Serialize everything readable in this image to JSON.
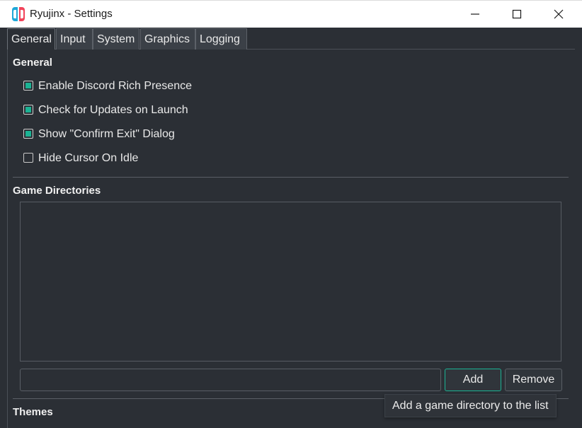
{
  "window": {
    "title": "Ryujinx - Settings",
    "controls": {
      "minimize": "minimize-icon",
      "maximize": "maximize-icon",
      "close": "close-icon"
    }
  },
  "tabs": [
    {
      "label": "General",
      "active": true
    },
    {
      "label": "Input",
      "active": false
    },
    {
      "label": "System",
      "active": false
    },
    {
      "label": "Graphics",
      "active": false
    },
    {
      "label": "Logging",
      "active": false
    }
  ],
  "general": {
    "header": "General",
    "options": [
      {
        "label": "Enable Discord Rich Presence",
        "checked": true
      },
      {
        "label": "Check for Updates on Launch",
        "checked": true
      },
      {
        "label": "Show \"Confirm Exit\" Dialog",
        "checked": true
      },
      {
        "label": "Hide Cursor On Idle",
        "checked": false
      }
    ]
  },
  "game_directories": {
    "header": "Game Directories",
    "directories": [],
    "path_input_value": "",
    "add_label": "Add",
    "remove_label": "Remove",
    "add_tooltip": "Add a game directory to the list"
  },
  "themes": {
    "header": "Themes"
  },
  "colors": {
    "accent": "#1bb394",
    "background": "#2b2f35",
    "titlebar": "#ffffff"
  }
}
